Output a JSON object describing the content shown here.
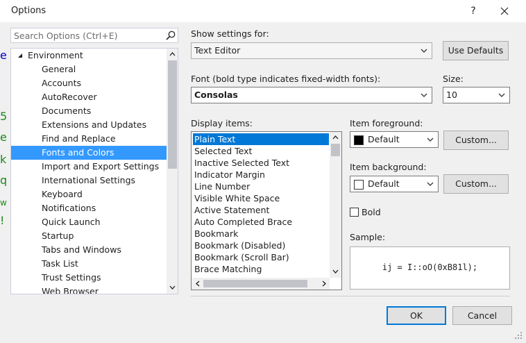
{
  "window": {
    "title": "Options",
    "help_label": "?",
    "close_label": "✕"
  },
  "search": {
    "placeholder": "Search Options (Ctrl+E)"
  },
  "tree": {
    "root": "Environment",
    "items": [
      {
        "label": "General",
        "selected": false
      },
      {
        "label": "Accounts",
        "selected": false
      },
      {
        "label": "AutoRecover",
        "selected": false
      },
      {
        "label": "Documents",
        "selected": false
      },
      {
        "label": "Extensions and Updates",
        "selected": false
      },
      {
        "label": "Find and Replace",
        "selected": false
      },
      {
        "label": "Fonts and Colors",
        "selected": true
      },
      {
        "label": "Import and Export Settings",
        "selected": false
      },
      {
        "label": "International Settings",
        "selected": false
      },
      {
        "label": "Keyboard",
        "selected": false
      },
      {
        "label": "Notifications",
        "selected": false
      },
      {
        "label": "Quick Launch",
        "selected": false
      },
      {
        "label": "Startup",
        "selected": false
      },
      {
        "label": "Tabs and Windows",
        "selected": false
      },
      {
        "label": "Task List",
        "selected": false
      },
      {
        "label": "Trust Settings",
        "selected": false
      },
      {
        "label": "Web Browser",
        "selected": false
      }
    ]
  },
  "bleed": [
    {
      "char": "e",
      "color": "#0000cc"
    },
    {
      "char": "5",
      "color": "#1a8a1a"
    },
    {
      "char": "e",
      "color": "#1a8a1a"
    },
    {
      "char": "k",
      "color": "#1a8a1a"
    },
    {
      "char": "q",
      "color": "#1a8a1a"
    },
    {
      "char": "w",
      "color": "#1a8a1a"
    },
    {
      "char": "!",
      "color": "#1a8a1a"
    }
  ],
  "settings": {
    "show_settings_label": "Show settings for:",
    "show_settings_value": "Text Editor",
    "use_defaults_label": "Use Defaults",
    "font_label": "Font (bold type indicates fixed-width fonts):",
    "font_value": "Consolas",
    "size_label": "Size:",
    "size_value": "10",
    "display_items_label": "Display items:",
    "display_items": [
      {
        "label": "Plain Text",
        "selected": true
      },
      {
        "label": "Selected Text",
        "selected": false
      },
      {
        "label": "Inactive Selected Text",
        "selected": false
      },
      {
        "label": "Indicator Margin",
        "selected": false
      },
      {
        "label": "Line Number",
        "selected": false
      },
      {
        "label": "Visible White Space",
        "selected": false
      },
      {
        "label": "Active Statement",
        "selected": false
      },
      {
        "label": "Auto Completed Brace",
        "selected": false
      },
      {
        "label": "Bookmark",
        "selected": false
      },
      {
        "label": "Bookmark (Disabled)",
        "selected": false
      },
      {
        "label": "Bookmark (Scroll Bar)",
        "selected": false
      },
      {
        "label": "Brace Matching",
        "selected": false
      }
    ],
    "item_foreground_label": "Item foreground:",
    "item_foreground_value": "Default",
    "item_foreground_color": "#000000",
    "item_background_label": "Item background:",
    "item_background_value": "Default",
    "item_background_color": "#ffffff",
    "custom_label": "Custom...",
    "bold_label": "Bold",
    "bold_checked": false,
    "sample_label": "Sample:",
    "sample_text": "ij = I::oO(0xB81l);"
  },
  "footer": {
    "ok_label": "OK",
    "cancel_label": "Cancel"
  },
  "colors": {
    "selection": "#3399ff",
    "list_selection": "#0078d7",
    "accent_border": "#0078d7"
  }
}
